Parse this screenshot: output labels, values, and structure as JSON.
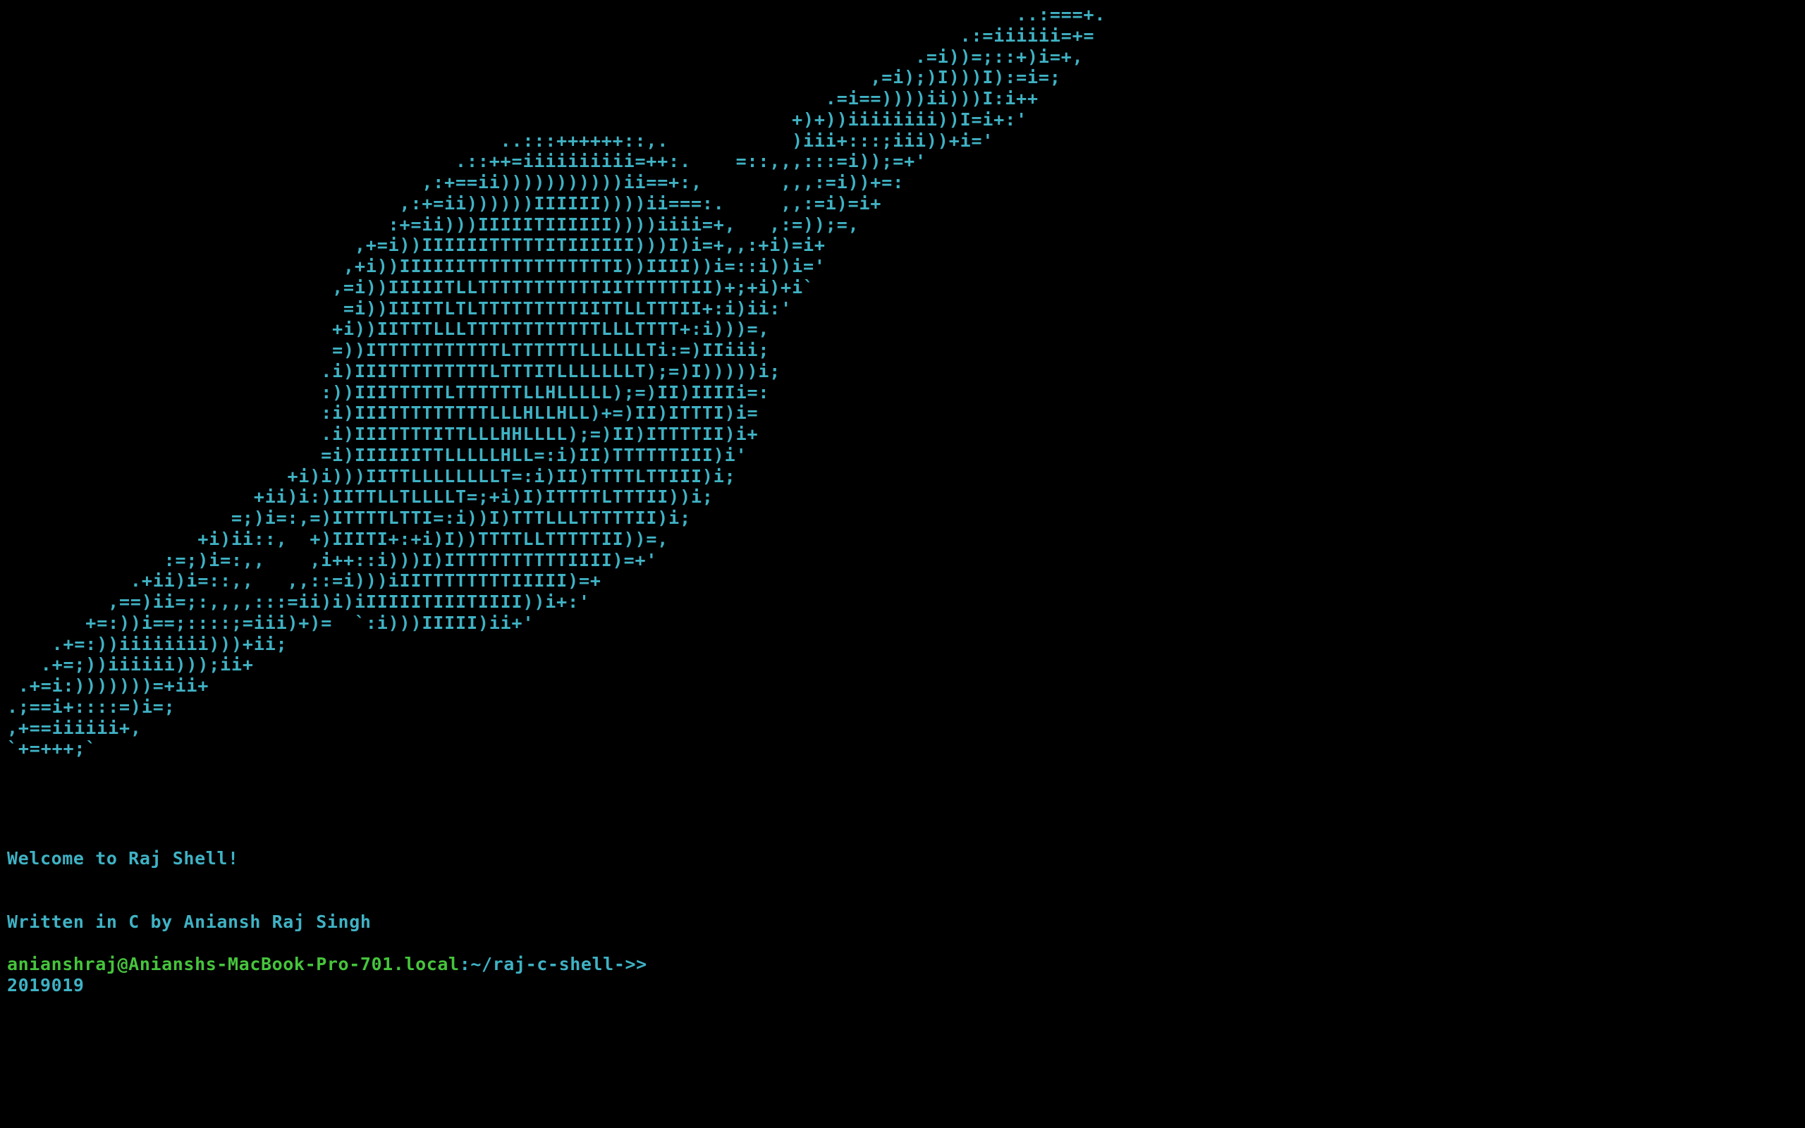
{
  "terminal": {
    "ascii_art": "                                                                                          ..:===+.\n                                                                                     .:=iiiiii=+=\n                                                                                 .=i))=;::+)i=+,\n                                                                             ,=i);)I)))I):=i=;\n                                                                         .=i==))))ii)))I:i++\n                                                                      +)+))iiiiiiii))I=i+:'\n                                            ..:::++++++::,.           )iii+:::;iii))+i='\n                                        .::++=iiiiiiiiii=++:.    =::,,,:::=i));=+'\n                                     ,:+==ii)))))))))))ii==+:,       ,,,:=i))+=:\n                                   ,:+=ii))))))IIIIII))))ii===:.     ,,:=i)=i+\n                                  :+=ii)))IIIIITIIIIII))))iiii=+,   ,:=));=,\n                               ,+=i))IIIIIITTTTTITIIIIII)))I)i=+,,:+i)=i+\n                              ,+i))IIIIIITTTTTTTTTTTTTI))IIII))i=::i))i='\n                             ,=i))IIIIITLLTTTTTTTTTTTIITTTTTTII)+;+i)+i`\n                              =i))IIITTLTLTTTTTTTTTIITTLLTTTII+:i)ii:'\n                             +i))IITTTLLLTTTTTTTTTTTTLLLTTTT+:i)))=,\n                             =))ITTTTTTTTTTTLTTTTTTLLLLLLTi:=)IIiii;\n                            .i)IIITTTTTTTTTLTTTITLLLLLLLT);=)I)))))i;\n                            :))IIITTTTTLTTTTTTLLHLLLLL);=)II)IIIIi=:\n                            :i)IIITTTTTTTTTLLLHLLHLL)+=)II)ITTTI)i=\n                            .i)IIITTTTITTLLLHHLLLL);=)II)ITTTTII)i+\n                            =i)IIIIIITTLLLLLHLL=:i)II)TTTTTTIII)i'\n                         +i)i)))IITTLLLLLLLLT=:i)II)TTTTLTTIII)i;\n                      +ii)i:)IITTLLTLLLLT=;+i)I)ITTTTLTTTII))i;\n                    =;)i=:,=)ITTTTLTTI=:i))I)TTTLLLTTTTTII)i;\n                 +i)ii::,  +)IIITI+:+i)I))TTTTLLTTTTTII))=,\n              :=;)i=:,,    ,i++::i)))I)ITTTTTTTTTTIIII)=+'\n           .+ii)i=::,,   ,,::=i)))iIITTTTTTTTIIIII)=+\n         ,==)ii=;:,,,,:::=ii)i)iIIIIITIIITIIII))i+:'\n       +=:))i==;::::;=iii)+)=  `:i)))IIIII)ii+'\n    .+=:))iiiiiiii)))+ii;\n   .+=;))iiiiii)));ii+\n .+=i:)))))))=+ii+\n.;==i+::::=)i=;\n,+==iiiiii+,\n`+=+++;`",
    "welcome_lines": [
      "Welcome to Raj Shell!",
      "Written in C by Aniansh Raj Singh",
      "2019019"
    ],
    "prompt": {
      "user_host": "anianshraj@Anianshs-MacBook-Pro-701.local",
      "path": ":~/raj-c-shell->>"
    },
    "colors": {
      "background": "#000000",
      "text_cyan": "#3fb2c4",
      "prompt_green": "#46c43c"
    }
  }
}
